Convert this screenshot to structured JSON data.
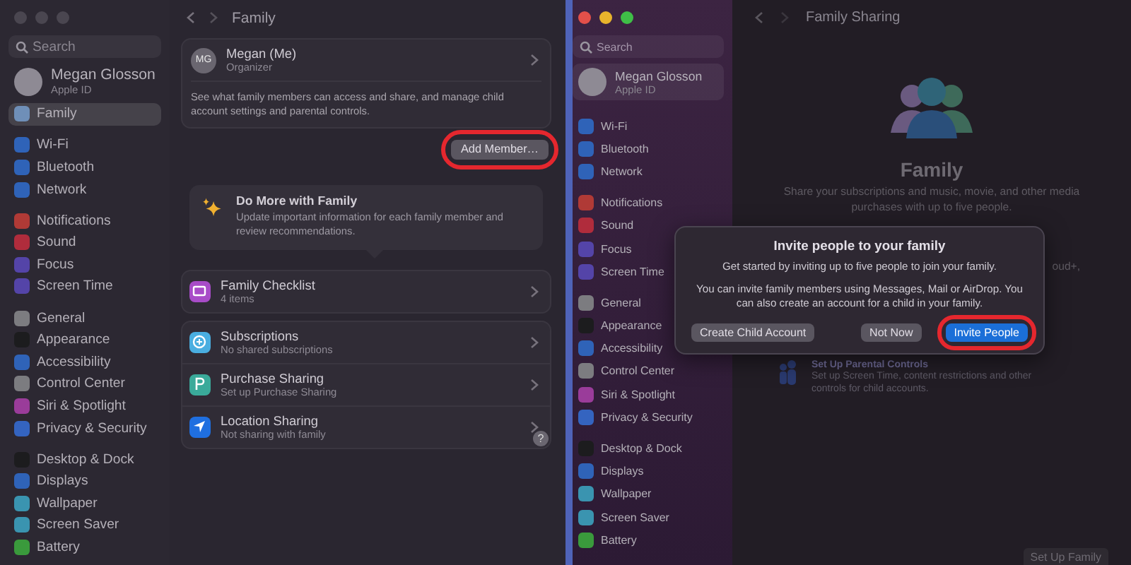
{
  "left": {
    "window_active": false,
    "sidebar": {
      "search_placeholder": "Search",
      "account": {
        "name": "Megan Glosson",
        "subtitle": "Apple ID",
        "selected": false
      },
      "groups": [
        {
          "items": [
            {
              "label": "Family",
              "color": "#6f8fb8",
              "selected": true
            }
          ]
        },
        {
          "items": [
            {
              "label": "Wi-Fi",
              "color": "#2f63b8",
              "selected": false
            },
            {
              "label": "Bluetooth",
              "color": "#2f63b8",
              "selected": false
            },
            {
              "label": "Network",
              "color": "#2f63b8",
              "selected": false
            }
          ]
        },
        {
          "items": [
            {
              "label": "Notifications",
              "color": "#b03a36",
              "selected": false
            },
            {
              "label": "Sound",
              "color": "#b02c3c",
              "selected": false
            },
            {
              "label": "Focus",
              "color": "#5444a8",
              "selected": false
            },
            {
              "label": "Screen Time",
              "color": "#5444a8",
              "selected": false
            }
          ]
        },
        {
          "items": [
            {
              "label": "General",
              "color": "#7c7c80",
              "selected": false
            },
            {
              "label": "Appearance",
              "color": "#1c1c1e",
              "selected": false
            },
            {
              "label": "Accessibility",
              "color": "#2f63b8",
              "selected": false
            },
            {
              "label": "Control Center",
              "color": "#7c7c80",
              "selected": false
            },
            {
              "label": "Siri & Spotlight",
              "color": "#9a3c9a",
              "selected": false
            },
            {
              "label": "Privacy & Security",
              "color": "#3464c0",
              "selected": false
            }
          ]
        },
        {
          "items": [
            {
              "label": "Desktop & Dock",
              "color": "#1c1c1e",
              "selected": false
            },
            {
              "label": "Displays",
              "color": "#2f63b8",
              "selected": false
            },
            {
              "label": "Wallpaper",
              "color": "#3a94b0",
              "selected": false
            },
            {
              "label": "Screen Saver",
              "color": "#3a94b0",
              "selected": false
            },
            {
              "label": "Battery",
              "color": "#3a9a3c",
              "selected": false
            }
          ]
        }
      ]
    },
    "detail": {
      "title": "Family",
      "organizer": {
        "initials": "MG",
        "name": "Megan (Me)",
        "role": "Organizer",
        "description": "See what family members can access and share, and manage child account settings and parental controls."
      },
      "add_button": {
        "label": "Add Member…",
        "highlighted": true
      },
      "tip": {
        "title": "Do More with Family",
        "text": "Update important information for each family member and review recommendations."
      },
      "sections": [
        {
          "rows": [
            {
              "kind": "checklist",
              "title": "Family Checklist",
              "subtitle": "4 items",
              "color": "#a84cc8"
            }
          ]
        },
        {
          "rows": [
            {
              "kind": "subscriptions",
              "title": "Subscriptions",
              "subtitle": "No shared subscriptions",
              "color": "#4aaee0"
            },
            {
              "kind": "purchase",
              "title": "Purchase Sharing",
              "subtitle": "Set up Purchase Sharing",
              "color": "#3aaa9a"
            },
            {
              "kind": "location",
              "title": "Location Sharing",
              "subtitle": "Not sharing with family",
              "color": "#1f6fe0"
            }
          ]
        }
      ],
      "help": "?"
    }
  },
  "right": {
    "window_active": true,
    "sidebar": {
      "search_placeholder": "Search",
      "account": {
        "name": "Megan Glosson",
        "subtitle": "Apple ID",
        "selected": true
      },
      "groups": [
        {
          "items": [
            {
              "label": "Wi-Fi",
              "color": "#2f63b8",
              "selected": false
            },
            {
              "label": "Bluetooth",
              "color": "#2f63b8",
              "selected": false
            },
            {
              "label": "Network",
              "color": "#2f63b8",
              "selected": false
            }
          ]
        },
        {
          "items": [
            {
              "label": "Notifications",
              "color": "#b03a36",
              "selected": false
            },
            {
              "label": "Sound",
              "color": "#b02c3c",
              "selected": false
            },
            {
              "label": "Focus",
              "color": "#5444a8",
              "selected": false
            },
            {
              "label": "Screen Time",
              "color": "#5444a8",
              "selected": false
            }
          ]
        },
        {
          "items": [
            {
              "label": "General",
              "color": "#7c7c80",
              "selected": false
            },
            {
              "label": "Appearance",
              "color": "#1c1c1e",
              "selected": false
            },
            {
              "label": "Accessibility",
              "color": "#2f63b8",
              "selected": false
            },
            {
              "label": "Control Center",
              "color": "#7c7c80",
              "selected": false
            },
            {
              "label": "Siri & Spotlight",
              "color": "#9a3c9a",
              "selected": false
            },
            {
              "label": "Privacy & Security",
              "color": "#3464c0",
              "selected": false
            }
          ]
        },
        {
          "items": [
            {
              "label": "Desktop & Dock",
              "color": "#1c1c1e",
              "selected": false
            },
            {
              "label": "Displays",
              "color": "#2f63b8",
              "selected": false
            },
            {
              "label": "Wallpaper",
              "color": "#3a94b0",
              "selected": false
            },
            {
              "label": "Screen Saver",
              "color": "#3a94b0",
              "selected": false
            },
            {
              "label": "Battery",
              "color": "#3a9a3c",
              "selected": false
            }
          ]
        }
      ]
    },
    "sharing": {
      "title": "Family Sharing",
      "heading": "Family",
      "text": "Share your subscriptions and music, movie, and other media purchases with up to five people.",
      "fragment": "oud+,",
      "feature": {
        "title": "Set Up Parental Controls",
        "text": "Set up Screen Time, content restrictions and other controls for child accounts."
      },
      "button": "Set Up Family",
      "dialog": {
        "title": "Invite people to your family",
        "paragraphs": [
          "Get started by inviting up to five people to join your family.",
          "You can invite family members using Messages, Mail or AirDrop. You can also create an account for a child in your family."
        ],
        "buttons": [
          {
            "label": "Create Child Account",
            "kind": "secondary",
            "highlighted": false
          },
          {
            "label": "Not Now",
            "kind": "secondary",
            "highlighted": false
          },
          {
            "label": "Invite People",
            "kind": "primary",
            "highlighted": true
          }
        ]
      }
    }
  }
}
